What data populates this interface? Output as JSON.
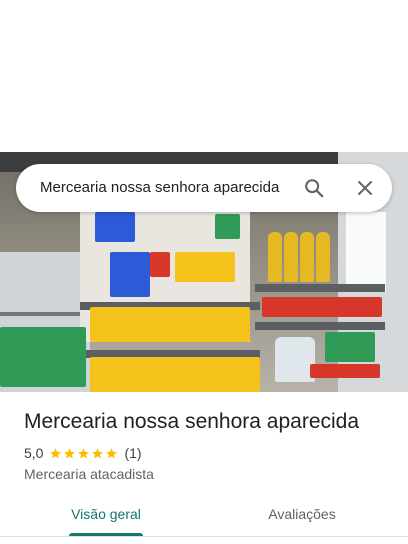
{
  "search": {
    "query": "Mercearia nossa senhora aparecida"
  },
  "place": {
    "name": "Mercearia nossa senhora aparecida",
    "rating": "5,0",
    "review_count": "(1)",
    "category": "Mercearia atacadista",
    "stars_filled": 5
  },
  "tabs": [
    {
      "label": "Visão geral",
      "selected": true
    },
    {
      "label": "Avaliações",
      "selected": false
    }
  ],
  "colors": {
    "accent": "#12776d",
    "star": "#fbbc04",
    "text_primary": "#202124",
    "text_secondary": "#5f6368"
  },
  "icons": [
    "search-icon",
    "close-icon",
    "star-icon"
  ]
}
